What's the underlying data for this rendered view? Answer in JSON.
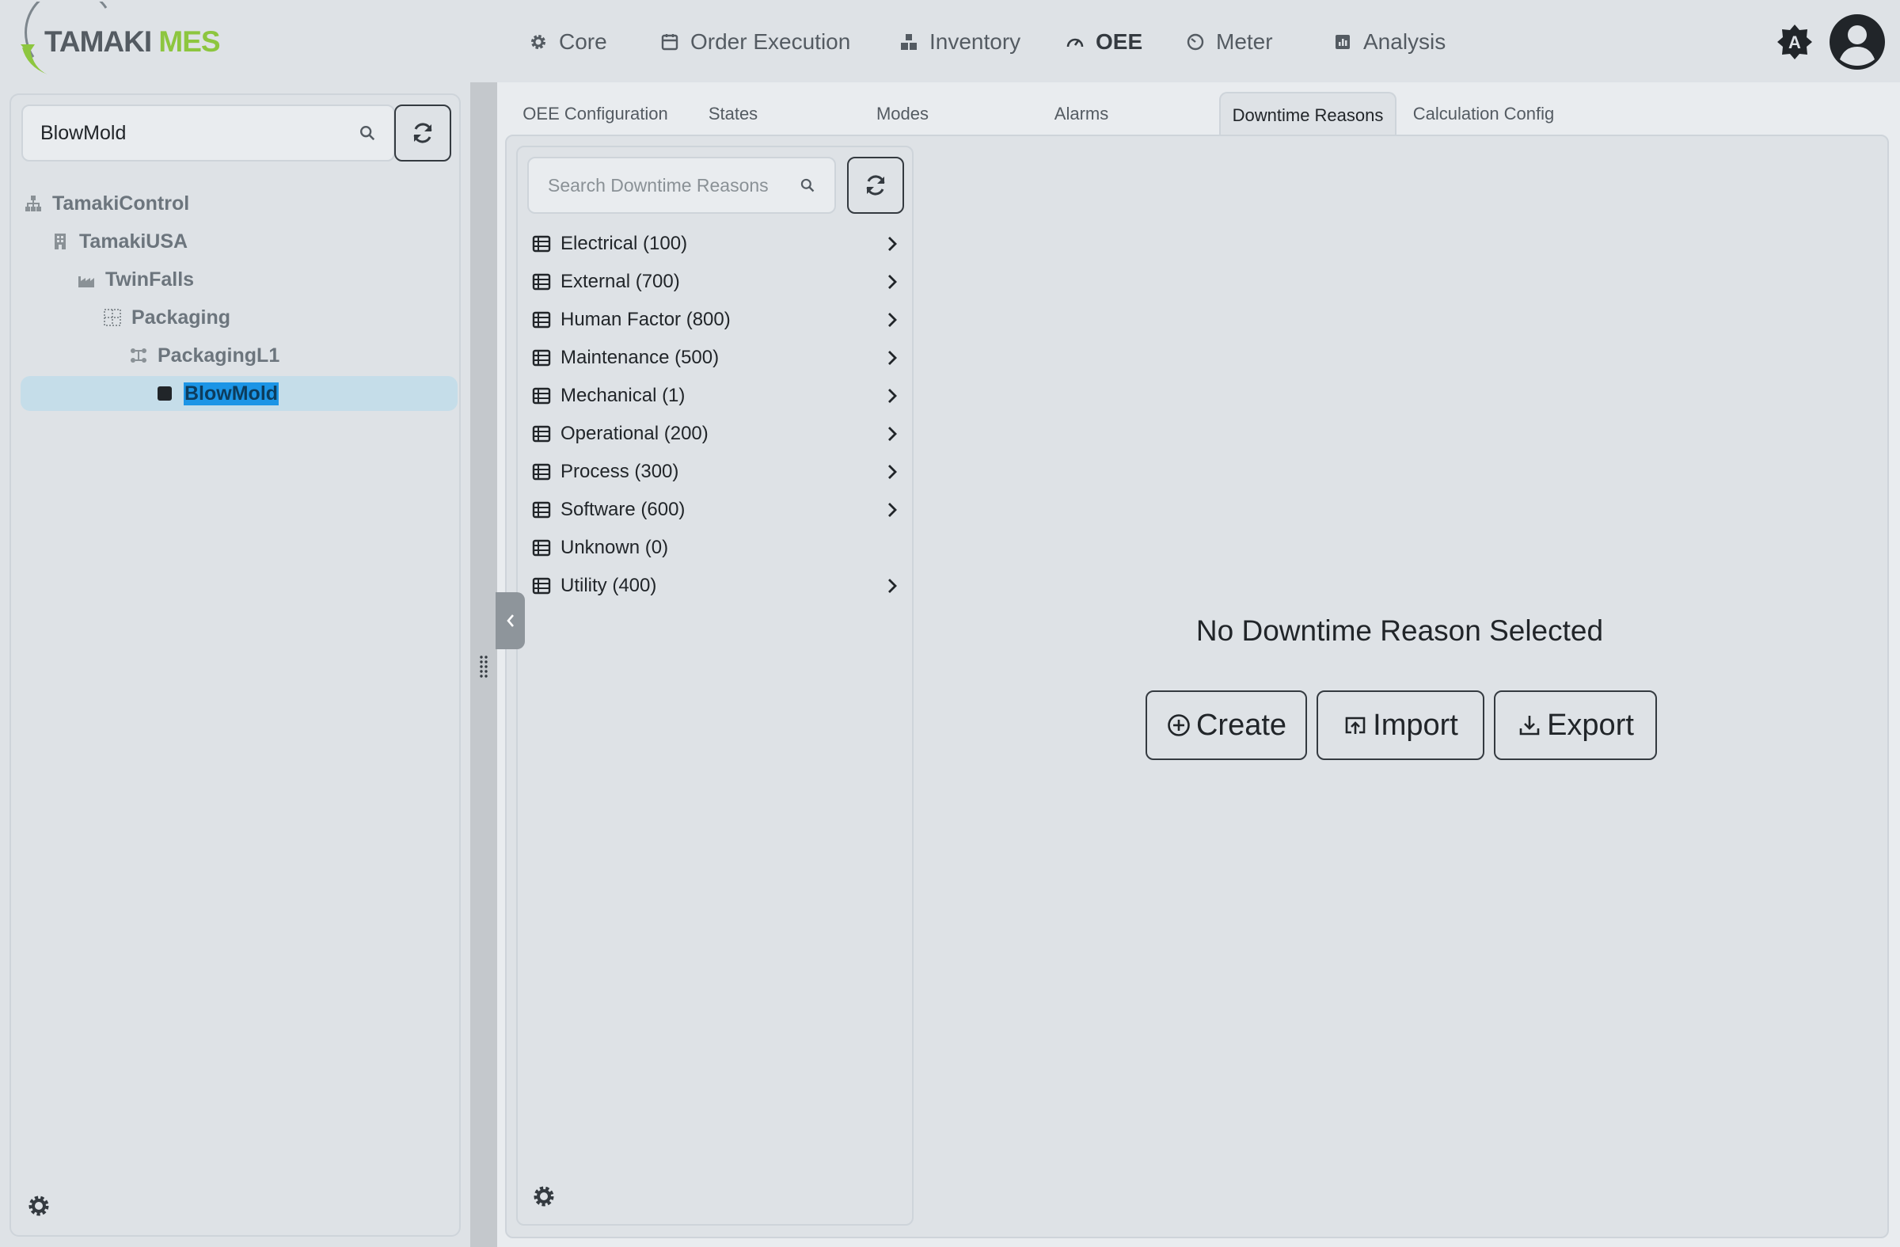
{
  "brand": {
    "name_part1": "TAMAKI",
    "name_part2": " MES",
    "accent": "#8dc63f"
  },
  "nav": {
    "items": [
      {
        "label": "Core",
        "icon": "gear-icon"
      },
      {
        "label": "Order Execution",
        "icon": "calendar-icon"
      },
      {
        "label": "Inventory",
        "icon": "boxes-icon"
      },
      {
        "label": "OEE",
        "icon": "speedometer-icon",
        "active": true
      },
      {
        "label": "Meter",
        "icon": "meter-icon"
      },
      {
        "label": "Analysis",
        "icon": "chart-icon"
      }
    ]
  },
  "left": {
    "search_value": "BlowMold",
    "tree": [
      {
        "label": "TamakiControl",
        "icon": "hierarchy-icon"
      },
      {
        "label": "TamakiUSA",
        "icon": "building-icon"
      },
      {
        "label": "TwinFalls",
        "icon": "factory-icon"
      },
      {
        "label": "Packaging",
        "icon": "grid-icon"
      },
      {
        "label": "PackagingL1",
        "icon": "line-icon"
      },
      {
        "label": "BlowMold",
        "icon": "square-icon",
        "selected": true
      }
    ]
  },
  "tabs": [
    {
      "label": "OEE Configuration"
    },
    {
      "label": "States"
    },
    {
      "label": "Modes"
    },
    {
      "label": "Alarms"
    },
    {
      "label": "Downtime Reasons",
      "active": true
    },
    {
      "label": "Calculation Config"
    }
  ],
  "reasons": {
    "search_placeholder": "Search Downtime Reasons",
    "items": [
      {
        "label": "Electrical (100)",
        "has_children": true
      },
      {
        "label": "External (700)",
        "has_children": true
      },
      {
        "label": "Human Factor (800)",
        "has_children": true
      },
      {
        "label": "Maintenance (500)",
        "has_children": true
      },
      {
        "label": "Mechanical (1)",
        "has_children": true
      },
      {
        "label": "Operational (200)",
        "has_children": true
      },
      {
        "label": "Process (300)",
        "has_children": true
      },
      {
        "label": "Software (600)",
        "has_children": true
      },
      {
        "label": "Unknown (0)",
        "has_children": false
      },
      {
        "label": "Utility (400)",
        "has_children": true
      }
    ]
  },
  "empty_state": {
    "title": "No Downtime Reason Selected",
    "create_label": "Create",
    "import_label": "Import",
    "export_label": "Export"
  },
  "colors": {
    "selected_bg": "#c5dde9",
    "selected_text_highlight": "#1c95e6"
  }
}
